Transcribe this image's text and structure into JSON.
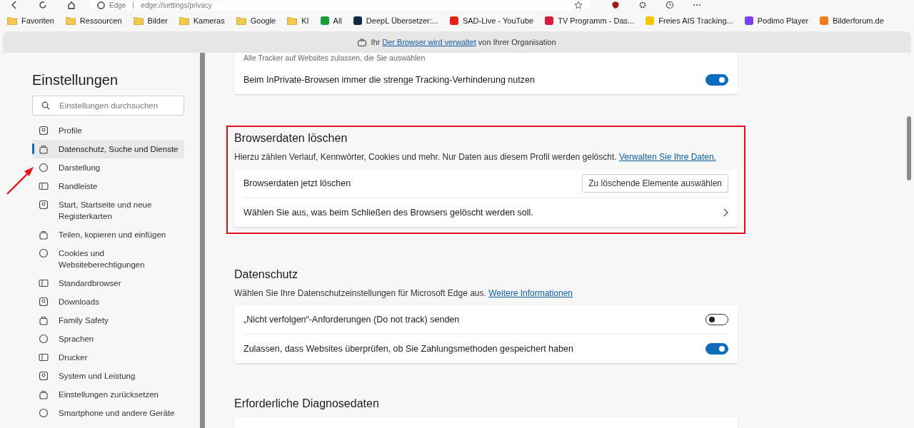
{
  "toolbar": {
    "site_label": "Edge",
    "address": "edge://settings/privacy"
  },
  "bookmarks": [
    {
      "label": "Favoriten",
      "kind": "folder"
    },
    {
      "label": "Ressourcen",
      "kind": "folder"
    },
    {
      "label": "Bilder",
      "kind": "folder"
    },
    {
      "label": "Kameras",
      "kind": "folder"
    },
    {
      "label": "Google",
      "kind": "folder"
    },
    {
      "label": "KI",
      "kind": "folder"
    },
    {
      "label": "All",
      "kind": "site",
      "color": "#1a9e3a"
    },
    {
      "label": "DeepL Übersetzer:...",
      "kind": "site",
      "color": "#0f2b46"
    },
    {
      "label": "SAD-Live - YouTube",
      "kind": "site",
      "color": "#e62117"
    },
    {
      "label": "TV Programm - Das...",
      "kind": "site",
      "color": "#d81b3c"
    },
    {
      "label": "Freies AIS Tracking...",
      "kind": "site",
      "color": "#f5c400"
    },
    {
      "label": "Podimo Player",
      "kind": "site",
      "color": "#7a3ff2"
    },
    {
      "label": "Bilderforum.de",
      "kind": "site",
      "color": "#f07c1c"
    }
  ],
  "banner": {
    "prefix": "Ihr",
    "link": "Der Browser wird verwaltet",
    "suffix": "von Ihrer Organisation"
  },
  "sidebar": {
    "title": "Einstellungen",
    "search": {
      "placeholder": "Einstellungen durchsuchen"
    },
    "items": [
      {
        "label": "Profile",
        "selected": false
      },
      {
        "label": "Datenschutz, Suche und Dienste",
        "selected": true
      },
      {
        "label": "Darstellung",
        "selected": false
      },
      {
        "label": "Randleiste",
        "selected": false
      },
      {
        "label": "Start, Startseite und neue Registerkarten",
        "selected": false
      },
      {
        "label": "Teilen, kopieren und einfügen",
        "selected": false
      },
      {
        "label": "Cookies und Websiteberechtigungen",
        "selected": false
      },
      {
        "label": "Standardbrowser",
        "selected": false
      },
      {
        "label": "Downloads",
        "selected": false
      },
      {
        "label": "Family Safety",
        "selected": false
      },
      {
        "label": "Sprachen",
        "selected": false
      },
      {
        "label": "Drucker",
        "selected": false
      },
      {
        "label": "System und Leistung",
        "selected": false
      },
      {
        "label": "Einstellungen zurücksetzen",
        "selected": false
      },
      {
        "label": "Smartphone und andere Geräte",
        "selected": false
      }
    ]
  },
  "sections": [
    {
      "highlighted": false,
      "rows": [
        {
          "kind": "note",
          "label": "Alle Tracker auf Websites zulassen, die Sie auswählen"
        },
        {
          "kind": "toggle",
          "label": "Beim InPrivate-Browsen immer die strenge Tracking-Verhinderung nutzen",
          "on": true
        }
      ]
    },
    {
      "title": "Browserdaten löschen",
      "description": "Hierzu zählen Verlauf, Kennwörter, Cookies und mehr. Nur Daten aus diesem Profil werden gelöscht.",
      "link": "Verwalten Sie Ihre Daten.",
      "highlighted": true,
      "rows": [
        {
          "kind": "button",
          "label": "Browserdaten jetzt löschen",
          "button": "Zu löschende Elemente auswählen"
        },
        {
          "kind": "nav",
          "label": "Wählen Sie aus, was beim Schließen des Browsers gelöscht werden soll."
        }
      ]
    },
    {
      "title": "Datenschutz",
      "description": "Wählen Sie Ihre Datenschutzeinstellungen für Microsoft Edge aus.",
      "link": "Weitere Informationen",
      "highlighted": false,
      "rows": [
        {
          "kind": "toggle",
          "label": "„Nicht verfolgen“-Anforderungen (Do not track) senden",
          "on": false
        },
        {
          "kind": "toggle",
          "label": "Zulassen, dass Websites überprüfen, ob Sie Zahlungsmethoden gespeichert haben",
          "on": true
        }
      ]
    },
    {
      "title": "Erforderliche Diagnosedaten",
      "highlighted": false
    }
  ]
}
